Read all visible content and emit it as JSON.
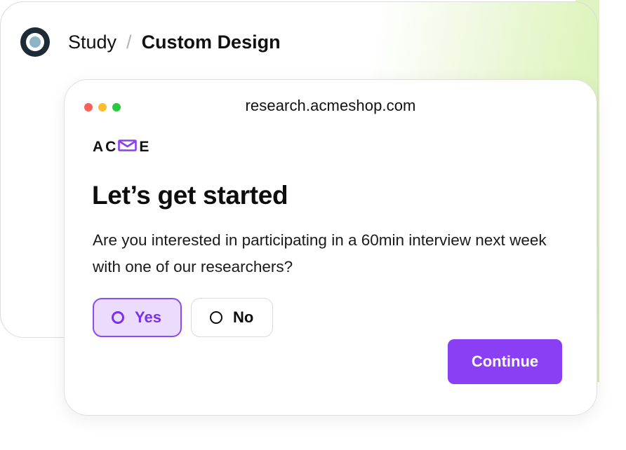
{
  "study": {
    "breadcrumb_root": "Study",
    "breadcrumb_separator": "/",
    "breadcrumb_current": "Custom Design",
    "logo_icon": "target-icon"
  },
  "browser": {
    "url": "research.acmeshop.com",
    "window_controls": [
      "close",
      "minimize",
      "maximize"
    ]
  },
  "page": {
    "brand_prefix": "AC",
    "brand_icon": "envelope-icon",
    "brand_suffix": "E",
    "headline": "Let’s get started",
    "question": "Are you interested in participating in a 60min interview next week with one of our researchers?",
    "options": [
      {
        "label": "Yes",
        "selected": true
      },
      {
        "label": "No",
        "selected": false
      }
    ],
    "continue_label": "Continue"
  },
  "colors": {
    "accent": "#8a3ff5",
    "accent_light": "#ebdcfd",
    "accent_text": "#7a2ff0",
    "background_tint": "#d6f2b0"
  }
}
